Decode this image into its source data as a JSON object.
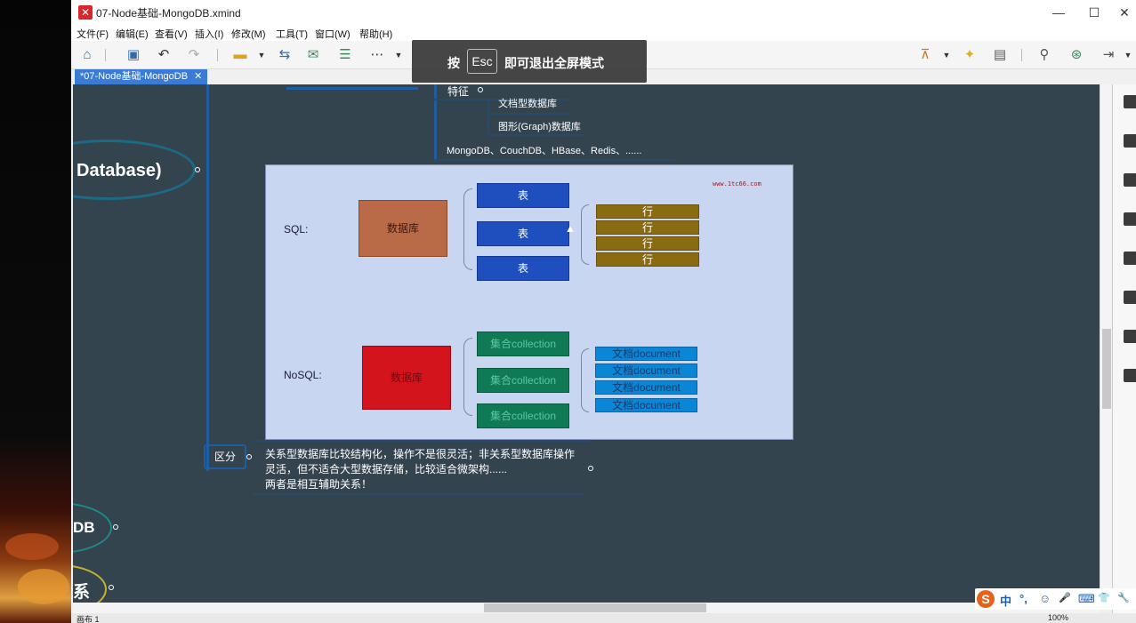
{
  "window": {
    "title": "07-Node基础-MongoDB.xmind",
    "minimize": "—",
    "maximize": "☐",
    "close": "✕"
  },
  "menu": [
    "文件(F)",
    "编辑(E)",
    "查看(V)",
    "插入(I)",
    "修改(M)",
    "工具(T)",
    "窗口(W)",
    "帮助(H)"
  ],
  "overlay": {
    "pre": "按",
    "key": "Esc",
    "post": "即可退出全屏模式"
  },
  "tab": {
    "label": "*07-Node基础-MongoDB",
    "close": "✕"
  },
  "mindmap": {
    "feature_label": "特征",
    "sub_items": [
      "文档型数据库",
      "图形(Graph)数据库"
    ],
    "examples": "MongoDB、CouchDB、HBase、Redis、......",
    "central": "Database)",
    "compare_label": "区分",
    "compare_text": [
      "关系型数据库比较结构化，操作不是很灵活；非关系型数据库操作",
      "灵活，但不适合大型数据存储，比较适合微架构......",
      "两者是相互辅助关系！"
    ],
    "mdb_label": "DB",
    "rel_label": "系"
  },
  "diagram": {
    "watermark": "www.1tc66.com",
    "sql_label": "SQL:",
    "nosql_label": "NoSQL:",
    "db_label": "数据库",
    "tables": [
      "表",
      "表",
      "表"
    ],
    "rows": [
      "行",
      "行",
      "行",
      "行"
    ],
    "collections": [
      "集合collection",
      "集合collection",
      "集合collection"
    ],
    "documents": [
      "文档document",
      "文档document",
      "文档document",
      "文档document"
    ],
    "colors": {
      "sql_db": "#b86b46",
      "nosql_db": "#d4141c",
      "table": "#1f4fbf",
      "row": "#8a6b12",
      "collection": "#0f7a55",
      "document": "#0a86d6"
    }
  },
  "status": {
    "left": "画布 1",
    "zoom": "100%"
  },
  "ime": {
    "items": [
      "中",
      "°,",
      "☺",
      "🎤",
      "⌨",
      "👕",
      "🔧"
    ]
  }
}
